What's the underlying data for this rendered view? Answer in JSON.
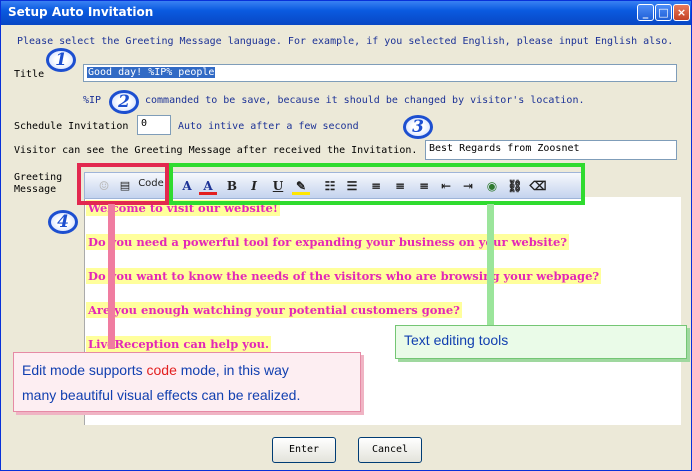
{
  "window": {
    "title": "Setup Auto Invitation",
    "min": "_",
    "max": "□",
    "close": "×"
  },
  "instructions": "Please select the Greeting Message language. For example, if you selected English, please input English also.",
  "title_field": {
    "label": "Title",
    "value": "Good day! %IP% people"
  },
  "note": {
    "prefix": "%IP",
    "suffix": "commanded to be save, because it should be changed by visitor's location."
  },
  "schedule": {
    "label": "Schedule Invitation",
    "value": "0",
    "suffix": "Auto intive after a few second"
  },
  "visitor": {
    "label": "Visitor can see the Greeting Message after received the Invitation.",
    "value": "Best Regards from Zoosnet"
  },
  "greeting": {
    "label_line1": "Greeting",
    "label_line2": "Message"
  },
  "toolbar": {
    "code_label": "Code",
    "bold": "B",
    "italic": "I",
    "underline": "U",
    "font_size": "A",
    "font_color": "A"
  },
  "message_lines": [
    "Welcome to visit our website!",
    "Do you need a powerful tool for expanding your business on your website?",
    "Do you want to know the needs of the visitors who are browsing your webpage?",
    "Are you enough watching your potential customers gone?",
    "LiveReception can help you."
  ],
  "badges": [
    "1",
    "2",
    "3",
    "4"
  ],
  "callouts": {
    "tools": "Text editing tools",
    "edit_mode_prefix": "Edit mode supports ",
    "edit_mode_code": "code",
    "edit_mode_suffix": " mode, in this way",
    "edit_mode_line2": "many beautiful visual effects can be realized."
  },
  "buttons": {
    "enter": "Enter",
    "cancel": "Cancel"
  },
  "colors": {
    "highlight": "#ffff9c",
    "message_text": "#e327b7",
    "title_bar": "#0a5ae0"
  }
}
